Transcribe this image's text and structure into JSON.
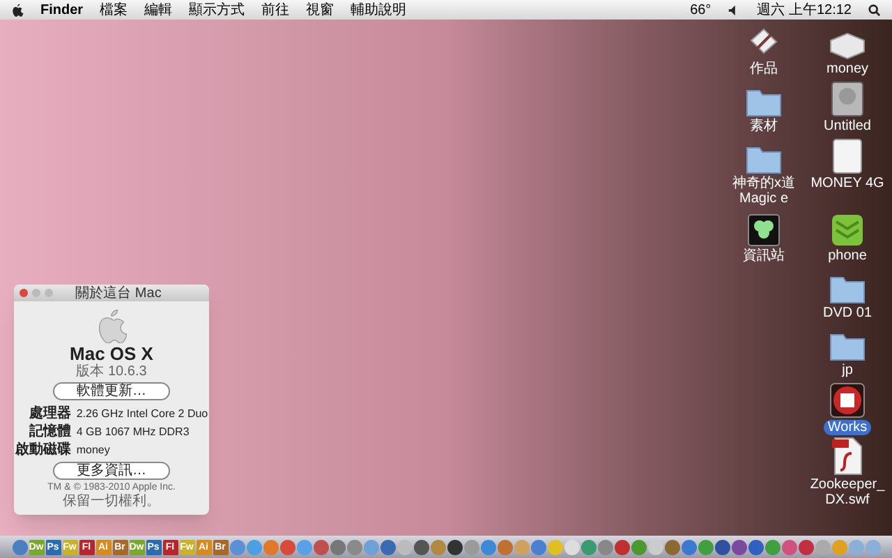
{
  "menu_bar": {
    "app": "Finder",
    "items": [
      "檔案",
      "編輯",
      "顯示方式",
      "前往",
      "視窗",
      "輔助說明"
    ],
    "temperature": "66°",
    "clock": "週六 上午12:12"
  },
  "desktop_icons": [
    {
      "label": "作品",
      "kind": "app"
    },
    {
      "label": "money",
      "kind": "drive"
    },
    {
      "label": "素材",
      "kind": "folder"
    },
    {
      "label": "Untitled",
      "kind": "disk"
    },
    {
      "label": "神奇的x道 Magic e",
      "kind": "folder"
    },
    {
      "label": "MONEY 4G",
      "kind": "usb"
    },
    {
      "label": "資訊站",
      "kind": "clover"
    },
    {
      "label": "phone",
      "kind": "green"
    },
    {
      "label": "DVD 01",
      "kind": "folder"
    },
    {
      "label": "jp",
      "kind": "folder"
    },
    {
      "label": "Works",
      "kind": "badge",
      "selected": true
    },
    {
      "label": "Zookeeper_DX.swf",
      "kind": "swf"
    }
  ],
  "about_window": {
    "title": "關於這台 Mac",
    "os_name": "Mac OS X",
    "version": "版本 10.6.3",
    "update_button": "軟體更新…",
    "specs": [
      {
        "label": "處理器",
        "value": "2.26 GHz Intel Core 2 Duo"
      },
      {
        "label": "記憶體",
        "value": "4 GB 1067 MHz DDR3"
      },
      {
        "label": "啟動磁碟",
        "value": "money"
      }
    ],
    "more_button": "更多資訊…",
    "copyright": "TM & © 1983-2010 Apple Inc.",
    "rights": "保留一切權利。"
  },
  "dock": [
    {
      "kind": "icon",
      "color": "#4a7fc0"
    },
    {
      "kind": "text",
      "label": "Dw",
      "color": "#7ba72a"
    },
    {
      "kind": "text",
      "label": "Ps",
      "color": "#2b6cb0"
    },
    {
      "kind": "text",
      "label": "Fw",
      "color": "#c9b227"
    },
    {
      "kind": "text",
      "label": "Fl",
      "color": "#b8252a"
    },
    {
      "kind": "text",
      "label": "Ai",
      "color": "#d98a1c"
    },
    {
      "kind": "text",
      "label": "Br",
      "color": "#a9682a"
    },
    {
      "kind": "text",
      "label": "Dw",
      "color": "#7ba72a"
    },
    {
      "kind": "text",
      "label": "Ps",
      "color": "#2b6cb0"
    },
    {
      "kind": "text",
      "label": "Fl",
      "color": "#b8252a"
    },
    {
      "kind": "text",
      "label": "Fw",
      "color": "#c9b227"
    },
    {
      "kind": "text",
      "label": "Ai",
      "color": "#d98a1c"
    },
    {
      "kind": "text",
      "label": "Br",
      "color": "#a9682a"
    },
    {
      "kind": "icon",
      "color": "#5b8fd6"
    },
    {
      "kind": "icon",
      "color": "#4aa0e0"
    },
    {
      "kind": "icon",
      "color": "#e07a2a"
    },
    {
      "kind": "icon",
      "color": "#d84a3a"
    },
    {
      "kind": "icon",
      "color": "#5aa0e8"
    },
    {
      "kind": "icon",
      "color": "#c05050"
    },
    {
      "kind": "icon",
      "color": "#777777"
    },
    {
      "kind": "icon",
      "color": "#8a8a8a"
    },
    {
      "kind": "icon",
      "color": "#6fa0d8"
    },
    {
      "kind": "icon",
      "color": "#3a6ab0"
    },
    {
      "kind": "icon",
      "color": "#bbbbbb"
    },
    {
      "kind": "icon",
      "color": "#555555"
    },
    {
      "kind": "icon",
      "color": "#b08a40"
    },
    {
      "kind": "icon",
      "color": "#333333"
    },
    {
      "kind": "icon",
      "color": "#9a9a9a"
    },
    {
      "kind": "icon",
      "color": "#3a8ad8"
    },
    {
      "kind": "icon",
      "color": "#c07030"
    },
    {
      "kind": "icon",
      "color": "#d0a060"
    },
    {
      "kind": "icon",
      "color": "#4a80d0"
    },
    {
      "kind": "icon",
      "color": "#e0c020"
    },
    {
      "kind": "icon",
      "color": "#dddddd"
    },
    {
      "kind": "icon",
      "color": "#3a9a70"
    },
    {
      "kind": "icon",
      "color": "#888888"
    },
    {
      "kind": "icon",
      "color": "#c03030"
    },
    {
      "kind": "icon",
      "color": "#4a9a30"
    },
    {
      "kind": "icon",
      "color": "#cccccc"
    },
    {
      "kind": "icon",
      "color": "#8a6a30"
    },
    {
      "kind": "icon",
      "color": "#3a7ad0"
    },
    {
      "kind": "icon",
      "color": "#40a040"
    },
    {
      "kind": "icon",
      "color": "#3050a0"
    },
    {
      "kind": "icon",
      "color": "#7a4aa0"
    },
    {
      "kind": "icon",
      "color": "#3060c0"
    },
    {
      "kind": "icon",
      "color": "#40a040"
    },
    {
      "kind": "icon",
      "color": "#d05080"
    },
    {
      "kind": "icon",
      "color": "#c03040"
    },
    {
      "kind": "icon",
      "color": "#aaaaaa"
    },
    {
      "kind": "icon",
      "color": "#e0a020"
    },
    {
      "kind": "icon",
      "color": "#8ab0d8"
    },
    {
      "kind": "icon",
      "color": "#8ab0d8"
    }
  ]
}
